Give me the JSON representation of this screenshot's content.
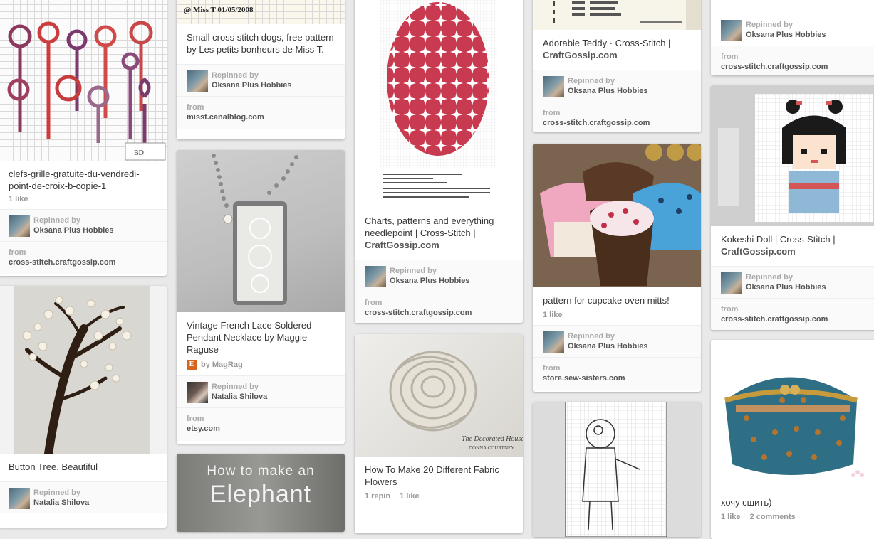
{
  "pins": [
    {
      "description": "clefs-grille-gratuite-du-vendredi-point-de-croix-b-copie-1",
      "likes": "1 like",
      "repinned_label": "Repinned by",
      "repinned_by": "Oksana Plus Hobbies",
      "from_label": "from",
      "source": "cross-stitch.craftgossip.com"
    },
    {
      "description": "Button Tree. Beautiful",
      "repinned_label": "Repinned by",
      "repinned_by": "Natalia Shilova"
    },
    {
      "image_caption": "@ Miss T 01/05/2008",
      "description": "Small cross stitch dogs, free pattern by Les petits bonheurs de Miss T.",
      "repinned_label": "Repinned by",
      "repinned_by": "Oksana Plus Hobbies",
      "from_label": "from",
      "source": "misst.canalblog.com"
    },
    {
      "description": "Vintage French Lace Soldered Pendant Necklace by Maggie Raguse",
      "via": "by MagRag",
      "repinned_label": "Repinned by",
      "repinned_by": "Natalia Shilova",
      "from_label": "from",
      "source": "etsy.com"
    },
    {
      "image_text_line1": "How to make an",
      "image_text_line2": "Elephant"
    },
    {
      "description": "Charts, patterns and everything needlepoint | Cross-Stitch |",
      "description_site": "CraftGossip.com",
      "repinned_label": "Repinned by",
      "repinned_by": "Oksana Plus Hobbies",
      "from_label": "from",
      "source": "cross-stitch.craftgossip.com"
    },
    {
      "description": "How To Make 20 Different Fabric Flowers",
      "repins": "1 repin",
      "likes": "1 like"
    },
    {
      "description": "Adorable Teddy · Cross-Stitch |",
      "description_site": "CraftGossip.com",
      "repinned_label": "Repinned by",
      "repinned_by": "Oksana Plus Hobbies",
      "from_label": "from",
      "source": "cross-stitch.craftgossip.com"
    },
    {
      "description": "pattern for cupcake oven mitts!",
      "likes": "1 like",
      "repinned_label": "Repinned by",
      "repinned_by": "Oksana Plus Hobbies",
      "from_label": "from",
      "source": "store.sew-sisters.com"
    },
    {
      "repinned_label": "Repinned by",
      "repinned_by": "Oksana Plus Hobbies",
      "from_label": "from",
      "source": "cross-stitch.craftgossip.com"
    },
    {
      "description": "Kokeshi Doll | Cross-Stitch |",
      "description_site": "CraftGossip.com",
      "repinned_label": "Repinned by",
      "repinned_by": "Oksana Plus Hobbies",
      "from_label": "from",
      "source": "cross-stitch.craftgossip.com"
    },
    {
      "description": "хочу сшить)",
      "likes": "1 like",
      "comments": "2 comments"
    }
  ]
}
